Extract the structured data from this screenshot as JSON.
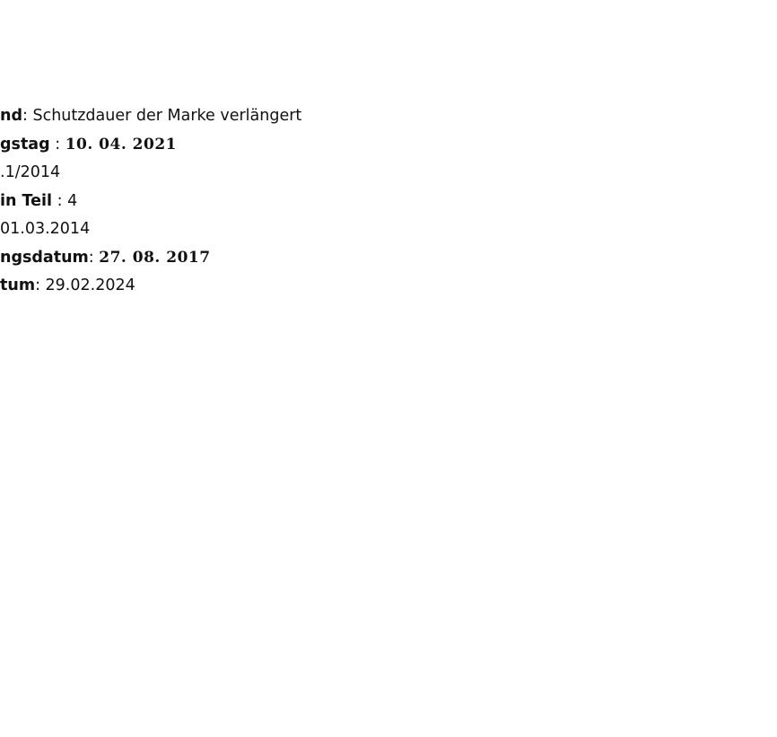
{
  "fields": [
    {
      "label": "nd",
      "separator": ": ",
      "value": "Schutzdauer der Marke verlängert"
    },
    {
      "label": "gstag",
      "separator": " : ",
      "value": "10. 04. 2021"
    },
    {
      "label": "",
      "separator": "",
      "value": ".1/2014"
    },
    {
      "label": " in Teil",
      "separator": " : ",
      "value": "4"
    },
    {
      "label": "",
      "separator": "",
      "value": " 01.03.2014"
    },
    {
      "label": "ngsdatum",
      "separator": ": ",
      "value": "27. 08. 2017"
    },
    {
      "label": "tum",
      "separator": ": ",
      "value": "29.02.2024"
    }
  ]
}
